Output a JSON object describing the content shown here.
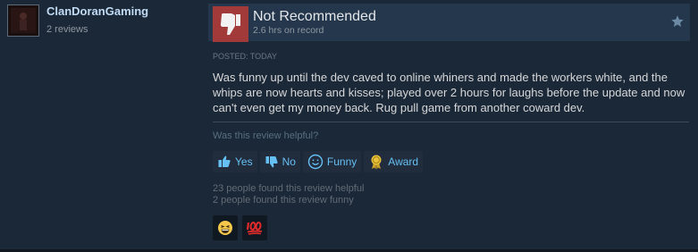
{
  "reviewer": {
    "username": "ClanDoranGaming",
    "reviews_count": "2 reviews"
  },
  "review": {
    "verdict": "Not Recommended",
    "hours": "2.6 hrs on record",
    "posted": "Posted: Today",
    "text": "Was funny up until the dev caved to online whiners and made the workers white, and the whips are now hearts and kisses; played over 2 hours for laughs before the update and now can't even get my money back. Rug pull game from another coward dev."
  },
  "helpful": {
    "question": "Was this review helpful?",
    "yes_label": "Yes",
    "no_label": "No",
    "funny_label": "Funny",
    "award_label": "Award",
    "helpful_count_text": "23 people found this review helpful",
    "funny_count_text": "2 people found this review funny"
  },
  "awards": [
    "laughing-face-award-icon",
    "hundred-points-award-icon"
  ],
  "colors": {
    "background": "#1b2838",
    "header": "#25374d",
    "thumb_down_bg": "#a33a3a",
    "link": "#66c0f4",
    "username": "#c1dbf4"
  }
}
